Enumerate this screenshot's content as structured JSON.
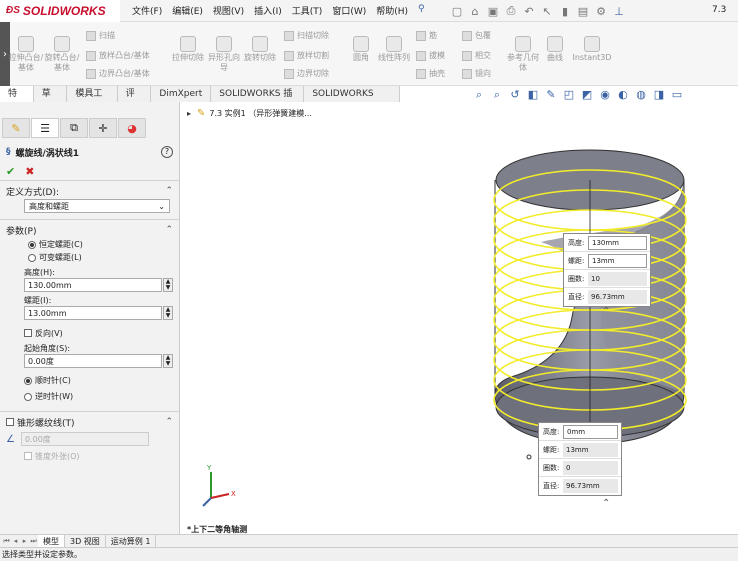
{
  "app": {
    "logo_text": "SOLIDWORKS",
    "doc_title": "7.3"
  },
  "menu": [
    "文件(F)",
    "编辑(E)",
    "视图(V)",
    "插入(I)",
    "工具(T)",
    "窗口(W)",
    "帮助(H)"
  ],
  "ribbon": {
    "large": [
      {
        "label": "拉伸凸台/基体"
      },
      {
        "label": "旋转凸台/基体"
      },
      {
        "label": "拉伸切除"
      },
      {
        "label": "异形孔向导"
      },
      {
        "label": "旋转切除"
      },
      {
        "label": "圆角"
      },
      {
        "label": "线性阵列"
      },
      {
        "label": "参考几何体"
      },
      {
        "label": "曲线"
      },
      {
        "label": "Instant3D"
      }
    ],
    "small": [
      "扫描",
      "放样凸台/基体",
      "边界凸台/基体",
      "扫描切除",
      "放样切割",
      "边界切除",
      "筋",
      "拔模",
      "抽壳",
      "包覆",
      "相交",
      "镜向"
    ]
  },
  "tabs": [
    "特征",
    "草图",
    "模具工具",
    "评估",
    "DimXpert",
    "SOLIDWORKS 插件",
    "SOLIDWORKS MBD"
  ],
  "panel": {
    "title": "螺旋线/涡状线1",
    "definition": {
      "header": "定义方式(D):",
      "selected": "高度和螺距"
    },
    "params": {
      "header": "参数(P)",
      "pitch_const": "恒定螺距(C)",
      "pitch_var": "可变螺距(L)",
      "height_label": "高度(H):",
      "height_value": "130.00mm",
      "pitch_label": "螺距(I):",
      "pitch_value": "13.00mm",
      "reverse_label": "反向(V)",
      "start_angle_label": "起始角度(S):",
      "start_angle_value": "0.00度",
      "cw_label": "顺时针(C)",
      "ccw_label": "逆时针(W)"
    },
    "taper": {
      "header": "锥形螺纹线(T)",
      "angle_value": "0.00度",
      "outward_label": "锥度外张(O)"
    }
  },
  "viewport": {
    "tree_item": "7.3 实例1 （异形弹簧建模...",
    "view_name": "*上下二等角轴测"
  },
  "callout_top": [
    {
      "k": "高度:",
      "v": "130mm"
    },
    {
      "k": "螺距:",
      "v": "13mm"
    },
    {
      "k": "圈数:",
      "v": "10"
    },
    {
      "k": "直径:",
      "v": "96.73mm"
    }
  ],
  "callout_bottom": [
    {
      "k": "高度:",
      "v": "0mm"
    },
    {
      "k": "螺距:",
      "v": "13mm"
    },
    {
      "k": "圈数:",
      "v": "0"
    },
    {
      "k": "直径:",
      "v": "96.73mm"
    }
  ],
  "bottom_tabs": [
    "模型",
    "3D 视图",
    "运动算例 1"
  ],
  "status": "选择类型并设定参数。"
}
